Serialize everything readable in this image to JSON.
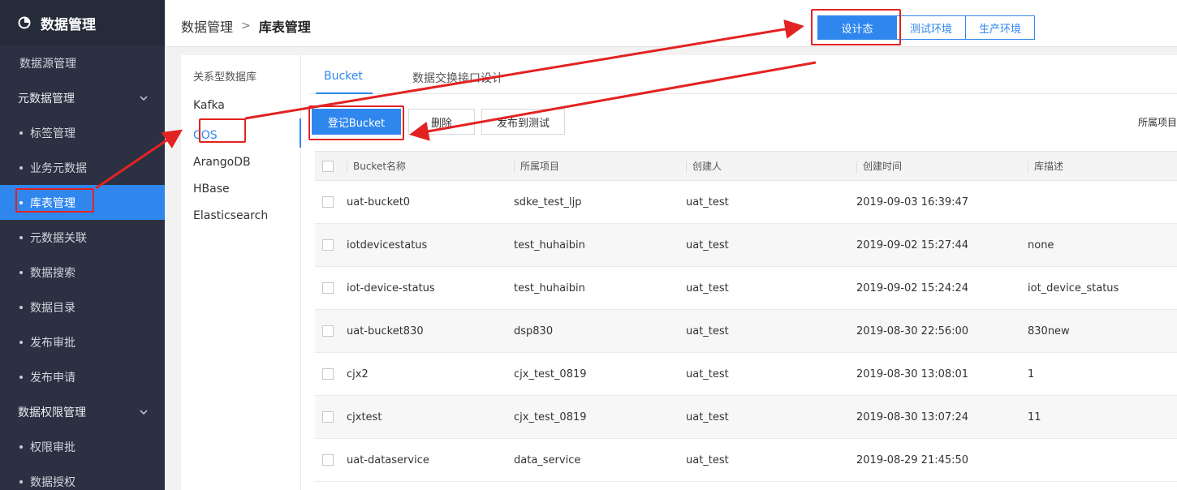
{
  "sidebar": {
    "brand": "数据管理",
    "items": [
      {
        "label": "数据源管理",
        "kind": "top"
      },
      {
        "label": "元数据管理",
        "kind": "group"
      },
      {
        "label": "标签管理",
        "kind": "sub"
      },
      {
        "label": "业务元数据",
        "kind": "sub"
      },
      {
        "label": "库表管理",
        "kind": "sub",
        "active": true
      },
      {
        "label": "元数据关联",
        "kind": "sub"
      },
      {
        "label": "数据搜索",
        "kind": "sub"
      },
      {
        "label": "数据目录",
        "kind": "sub"
      },
      {
        "label": "发布审批",
        "kind": "sub"
      },
      {
        "label": "发布申请",
        "kind": "sub"
      },
      {
        "label": "数据权限管理",
        "kind": "group"
      },
      {
        "label": "权限审批",
        "kind": "sub"
      },
      {
        "label": "数据授权",
        "kind": "sub"
      }
    ]
  },
  "header": {
    "breadcrumb_root": "数据管理",
    "breadcrumb_sep": ">",
    "breadcrumb_current": "库表管理",
    "env_buttons": [
      "设计态",
      "测试环境",
      "生产环境"
    ]
  },
  "dbnav": {
    "items": [
      "关系型数据库",
      "Kafka",
      "COS",
      "ArangoDB",
      "HBase",
      "Elasticsearch"
    ],
    "active": "COS"
  },
  "tabs": [
    "Bucket",
    "数据交换接口设计"
  ],
  "toolbar": {
    "register": "登记Bucket",
    "delete": "删除",
    "publish": "发布到测试",
    "right_label": "所属项目"
  },
  "table": {
    "columns": [
      "Bucket名称",
      "所属项目",
      "创建人",
      "创建时间",
      "库描述"
    ],
    "rows": [
      [
        "uat-bucket0",
        "sdke_test_ljp",
        "uat_test",
        "2019-09-03 16:39:47",
        ""
      ],
      [
        "iotdevicestatus",
        "test_huhaibin",
        "uat_test",
        "2019-09-02 15:27:44",
        "none"
      ],
      [
        "iot-device-status",
        "test_huhaibin",
        "uat_test",
        "2019-09-02 15:24:24",
        "iot_device_status"
      ],
      [
        "uat-bucket830",
        "dsp830",
        "uat_test",
        "2019-08-30 22:56:00",
        "830new"
      ],
      [
        "cjx2",
        "cjx_test_0819",
        "uat_test",
        "2019-08-30 13:08:01",
        "1"
      ],
      [
        "cjxtest",
        "cjx_test_0819",
        "uat_test",
        "2019-08-30 13:07:24",
        "11"
      ],
      [
        "uat-dataservice",
        "data_service",
        "uat_test",
        "2019-08-29 21:45:50",
        ""
      ]
    ]
  },
  "colors": {
    "accent": "#2f87ee",
    "sidebar_bg": "#2b3142",
    "annotation_red": "#e32222"
  }
}
